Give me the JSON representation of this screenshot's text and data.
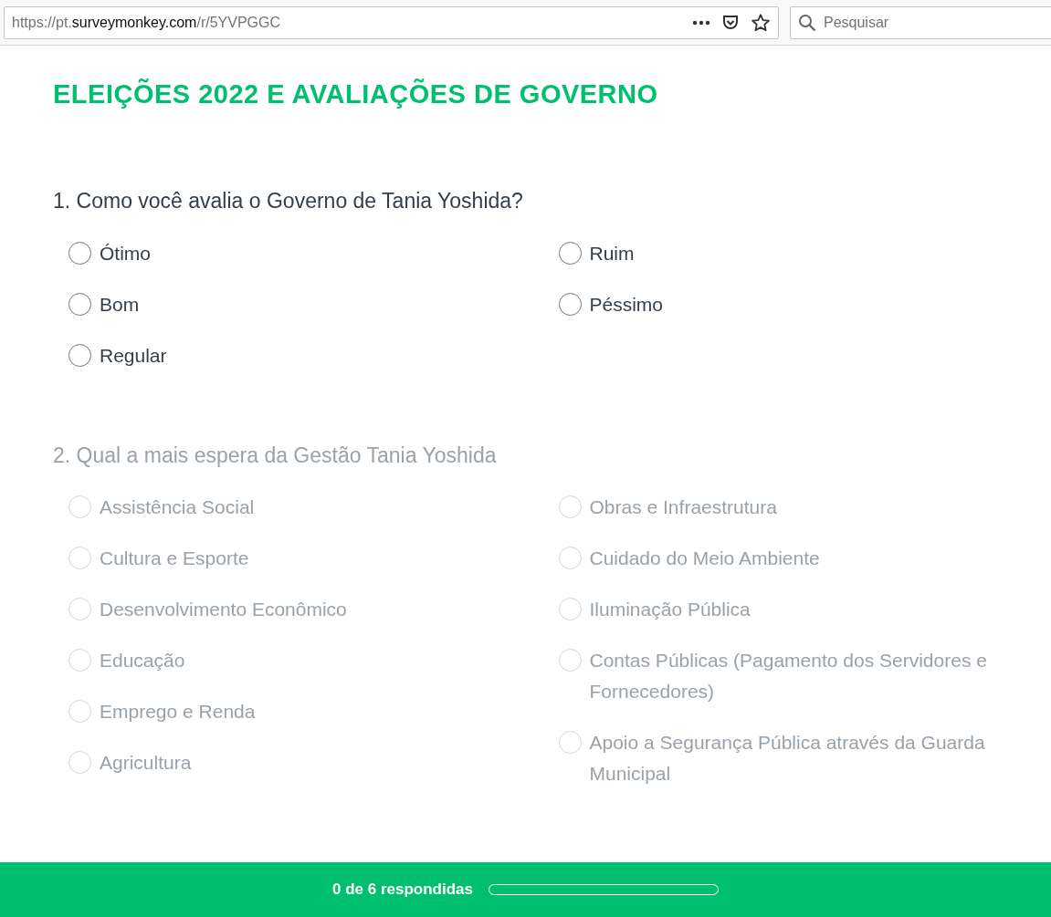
{
  "browser": {
    "url_prefix": "https://pt.",
    "url_domain": "surveymonkey.com",
    "url_path": "/r/5YVPGGC",
    "search": {
      "placeholder": "Pesquisar"
    }
  },
  "survey": {
    "title": "ELEIÇÕES 2022 E AVALIAÇÕES DE GOVERNO",
    "questions": [
      {
        "text": "1. Como você avalia o Governo de Tania Yoshida?",
        "active": true,
        "columns": [
          [
            {
              "label": "Ótimo",
              "selected": false
            },
            {
              "label": "Bom",
              "selected": false
            },
            {
              "label": "Regular",
              "selected": false
            }
          ],
          [
            {
              "label": "Ruim",
              "selected": false
            },
            {
              "label": "Péssimo",
              "selected": false
            }
          ]
        ]
      },
      {
        "text": "2. Qual a mais espera da Gestão Tania Yoshida",
        "active": false,
        "columns": [
          [
            {
              "label": "Assistência Social",
              "selected": false
            },
            {
              "label": "Cultura e Esporte",
              "selected": false
            },
            {
              "label": "Desenvolvimento Econômico",
              "selected": false
            },
            {
              "label": "Educação",
              "selected": false
            },
            {
              "label": "Emprego e Renda",
              "selected": false
            },
            {
              "label": "Agricultura",
              "selected": false
            }
          ],
          [
            {
              "label": "Obras e Infraestrutura",
              "selected": false
            },
            {
              "label": "Cuidado do Meio Ambiente",
              "selected": false
            },
            {
              "label": "Iluminação Pública",
              "selected": false
            },
            {
              "label": "Contas Públicas (Pagamento dos Servidores e Fornecedores)",
              "selected": false
            },
            {
              "label": "Apoio a Segurança Pública através da Guarda Municipal",
              "selected": false
            }
          ]
        ]
      }
    ]
  },
  "footer": {
    "progress_text": "0 de 6 respondidas",
    "level": 0
  }
}
